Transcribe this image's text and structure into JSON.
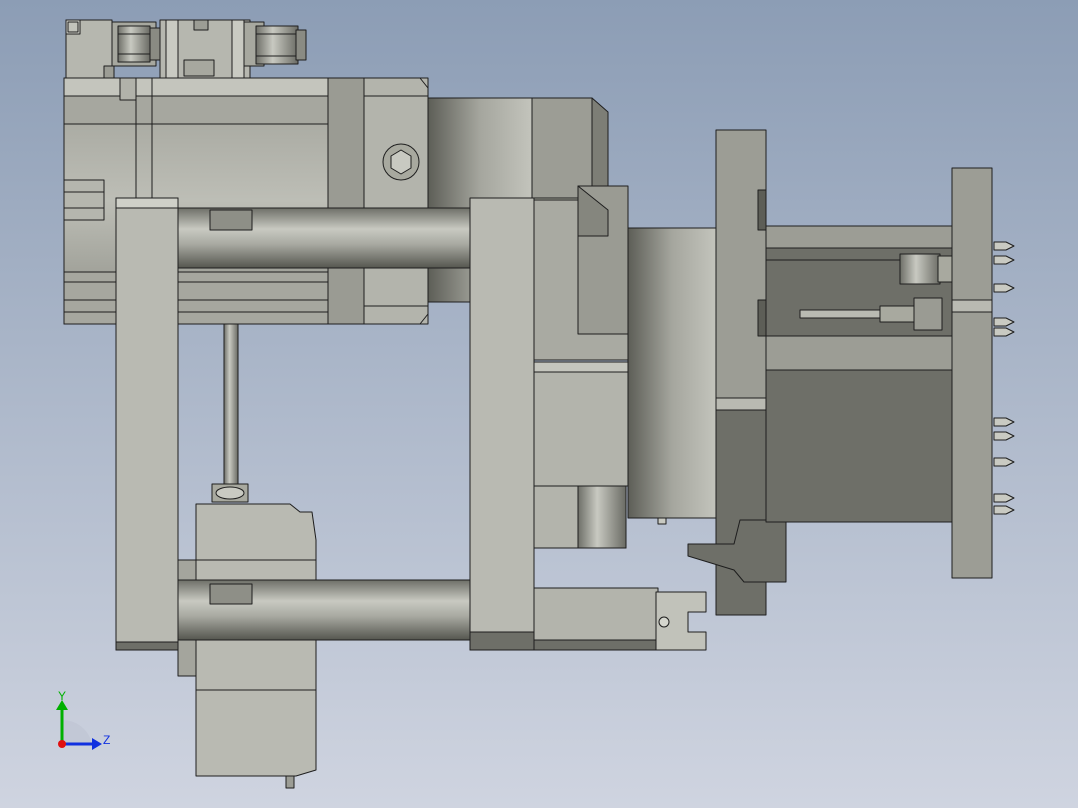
{
  "viewport": {
    "background_top": "#8c9db5",
    "background_bottom": "#cfd4e0"
  },
  "palette": {
    "light_gray": "#b9bab2",
    "mid_gray": "#9c9d95",
    "dark_gray": "#6e6f68",
    "shade_gray": "#86877f",
    "outline": "#1e1e1e"
  },
  "triad": {
    "y_label": "Y",
    "z_label": "Z",
    "y_color": "#00b000",
    "z_color": "#1030e0",
    "x_color": "#e01010"
  }
}
